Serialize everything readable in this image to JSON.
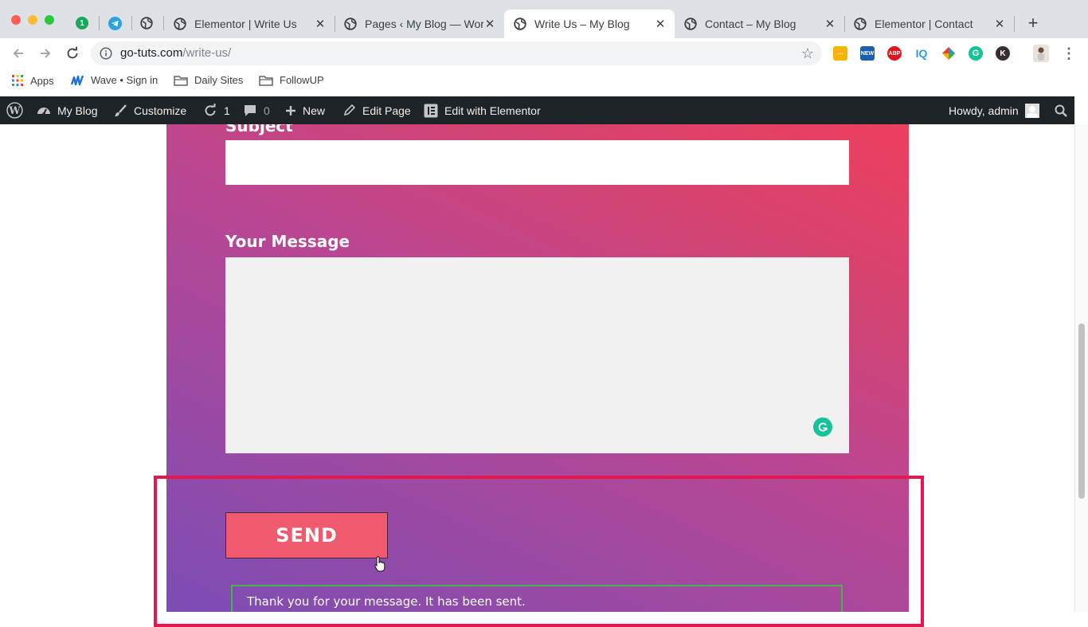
{
  "browser": {
    "tabs": [
      {
        "label": "Elementor | Write Us",
        "active": false
      },
      {
        "label": "Pages ‹ My Blog — WordPress",
        "active": false
      },
      {
        "label": "Write Us – My Blog",
        "active": true
      },
      {
        "label": "Contact – My Blog",
        "active": false
      },
      {
        "label": "Elementor | Contact",
        "active": false
      }
    ],
    "pinned_badge": "1",
    "close_glyph": "✕",
    "new_tab_glyph": "+",
    "url_host": "go-tuts.com",
    "url_path": "/write-us/",
    "extension_icons": [
      "notes-icon",
      "news-icon",
      "adblock-plus-icon",
      "iq-icon",
      "colorful-icon",
      "grammarly-icon",
      "k-icon",
      "profile-avatar",
      "menu-icon"
    ],
    "abp_text": "ABP",
    "iq_text": "IQ",
    "new_text": "NEW",
    "k_text": "K"
  },
  "bookmarks": [
    {
      "label": "Apps",
      "icon": "apps-grid-icon"
    },
    {
      "label": "Wave • Sign in",
      "icon": "wave-icon"
    },
    {
      "label": "Daily Sites",
      "icon": "folder-icon"
    },
    {
      "label": "FollowUP",
      "icon": "folder-icon"
    }
  ],
  "admin_bar": {
    "site_name": "My Blog",
    "customize": "Customize",
    "updates_count": "1",
    "comments_count": "0",
    "new": "New",
    "edit_page": "Edit Page",
    "edit_with_elementor": "Edit with Elementor",
    "howdy": "Howdy, admin"
  },
  "form": {
    "subject_label": "Subject",
    "message_label": "Your Message",
    "send_button": "SEND",
    "response_message": "Thank you for your message. It has been sent."
  },
  "colors": {
    "gradient_start": "#7c4db5",
    "gradient_end": "#ee3f5e",
    "send_button": "#f05a6e",
    "highlight_box": "#e8164f",
    "success_border": "#46b450",
    "admin_bar": "#1d2327"
  }
}
